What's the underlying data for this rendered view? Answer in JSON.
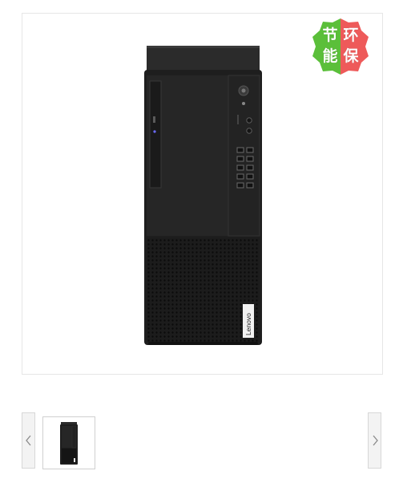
{
  "product": {
    "image_name": "lenovo-tower-pc",
    "brand_mark": "Lenovo"
  },
  "eco_badge": {
    "chars": [
      "节",
      "环",
      "能",
      "保"
    ],
    "colors": {
      "left": "#5bbf3a",
      "right": "#ee5a5a"
    }
  },
  "gallery": {
    "prev_icon": "chevron-left-icon",
    "next_icon": "chevron-right-icon",
    "thumbnails": [
      "tower-pc-thumbnail"
    ],
    "selected_index": 0
  }
}
